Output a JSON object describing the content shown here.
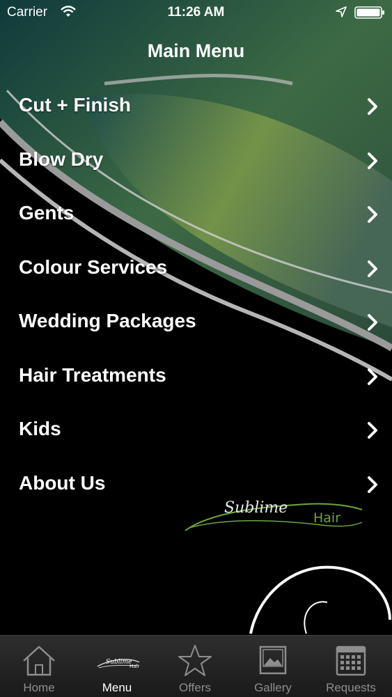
{
  "status_bar": {
    "carrier": "Carrier",
    "time": "11:26 AM",
    "icons": [
      "wifi-icon",
      "location-arrow-icon",
      "battery-icon"
    ]
  },
  "nav": {
    "title": "Main Menu"
  },
  "menu": {
    "items": [
      {
        "label": "Cut + Finish"
      },
      {
        "label": "Blow Dry"
      },
      {
        "label": "Gents"
      },
      {
        "label": "Colour Services"
      },
      {
        "label": "Wedding Packages"
      },
      {
        "label": "Hair Treatments"
      },
      {
        "label": "Kids"
      },
      {
        "label": "About Us"
      }
    ],
    "chevron_icon": "chevron-right-icon"
  },
  "logo": {
    "word1": "Sublime",
    "word2": "Hair"
  },
  "tab_bar": {
    "tabs": [
      {
        "label": "Home",
        "icon": "home-icon"
      },
      {
        "label": "Menu",
        "icon": "sublime-logo-icon",
        "active": true
      },
      {
        "label": "Offers",
        "icon": "star-icon"
      },
      {
        "label": "Gallery",
        "icon": "picture-icon"
      },
      {
        "label": "Requests",
        "icon": "calendar-icon"
      }
    ]
  },
  "colors": {
    "accent_green": "#6fa63a",
    "background": "#000000",
    "tab_inactive": "#8e8e8e"
  }
}
